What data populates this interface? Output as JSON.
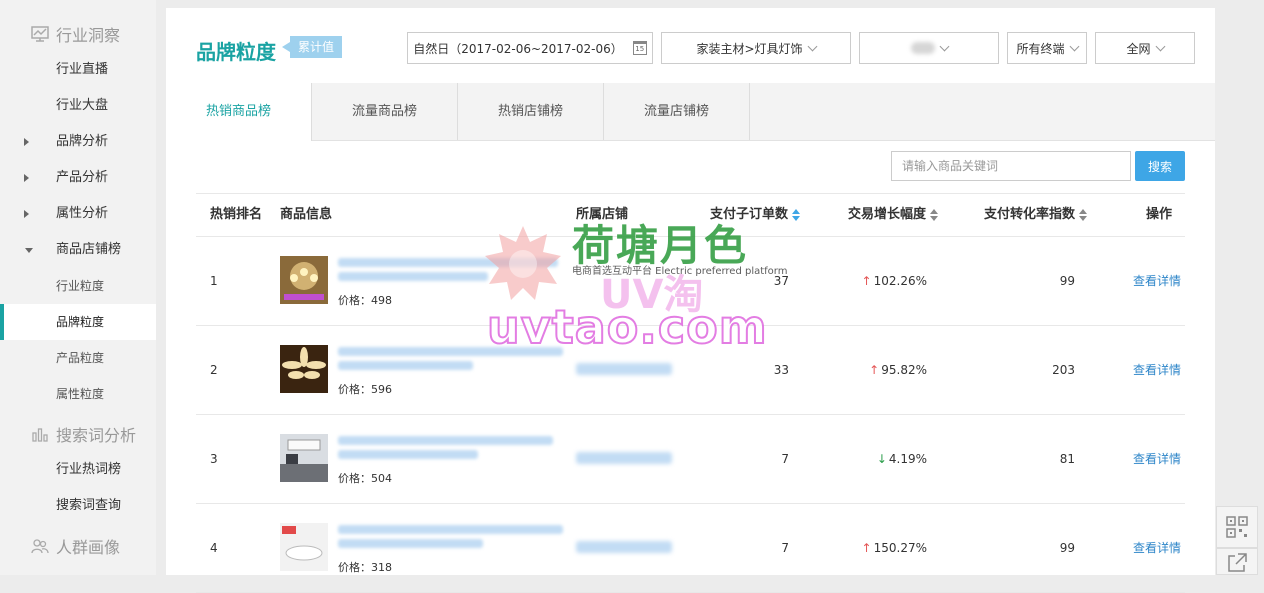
{
  "sidebar": {
    "groups": [
      {
        "label": "行业洞察",
        "icon": "chart-monitor-icon"
      },
      {
        "label": "搜索词分析",
        "icon": "bar-chart-icon"
      },
      {
        "label": "人群画像",
        "icon": "users-icon"
      }
    ],
    "items": [
      {
        "label": "行业直播"
      },
      {
        "label": "行业大盘"
      },
      {
        "label": "品牌分析"
      },
      {
        "label": "产品分析"
      },
      {
        "label": "属性分析"
      },
      {
        "label": "商品店铺榜"
      },
      {
        "label": "行业粒度"
      },
      {
        "label": "品牌粒度"
      },
      {
        "label": "产品粒度"
      },
      {
        "label": "属性粒度"
      },
      {
        "label": "行业热词榜"
      },
      {
        "label": "搜索词查询"
      }
    ]
  },
  "header": {
    "title": "品牌粒度",
    "badge": "累计值",
    "date_range": "自然日（2017-02-06~2017-02-06）",
    "calendar_day": "15",
    "category": "家装主材>灯具灯饰",
    "terminal": "所有终端",
    "network": "全网"
  },
  "tabs": [
    {
      "label": "热销商品榜",
      "active": true
    },
    {
      "label": "流量商品榜",
      "active": false
    },
    {
      "label": "热销店铺榜",
      "active": false
    },
    {
      "label": "流量店铺榜",
      "active": false
    }
  ],
  "search": {
    "placeholder": "请输入商品关键词",
    "button": "搜索"
  },
  "table": {
    "headers": {
      "rank": "热销排名",
      "product": "商品信息",
      "shop": "所属店铺",
      "orders": "支付子订单数",
      "growth": "交易增长幅度",
      "conversion": "支付转化率指数",
      "action": "操作"
    },
    "rows": [
      {
        "rank": "1",
        "price": "价格：498",
        "orders": "37",
        "growth": "102.26%",
        "direction": "up",
        "conversion": "99",
        "action": "查看详情"
      },
      {
        "rank": "2",
        "price": "价格：596",
        "orders": "33",
        "growth": "95.82%",
        "direction": "up",
        "conversion": "203",
        "action": "查看详情"
      },
      {
        "rank": "3",
        "price": "价格：504",
        "orders": "7",
        "growth": "4.19%",
        "direction": "down",
        "conversion": "81",
        "action": "查看详情"
      },
      {
        "rank": "4",
        "price": "价格：318",
        "orders": "7",
        "growth": "150.27%",
        "direction": "up",
        "conversion": "99",
        "action": "查看详情"
      }
    ]
  },
  "watermark": {
    "brand": "荷塘月色",
    "tagline": "电商首选互动平台 Electric preferred platform",
    "logo_text": "UV淘",
    "url": "uvtao.com"
  },
  "colors": {
    "accent": "#1aa3a3",
    "link": "#2e86c9",
    "button": "#3ea6e6",
    "up": "#e45555",
    "down": "#2a9d4a"
  }
}
